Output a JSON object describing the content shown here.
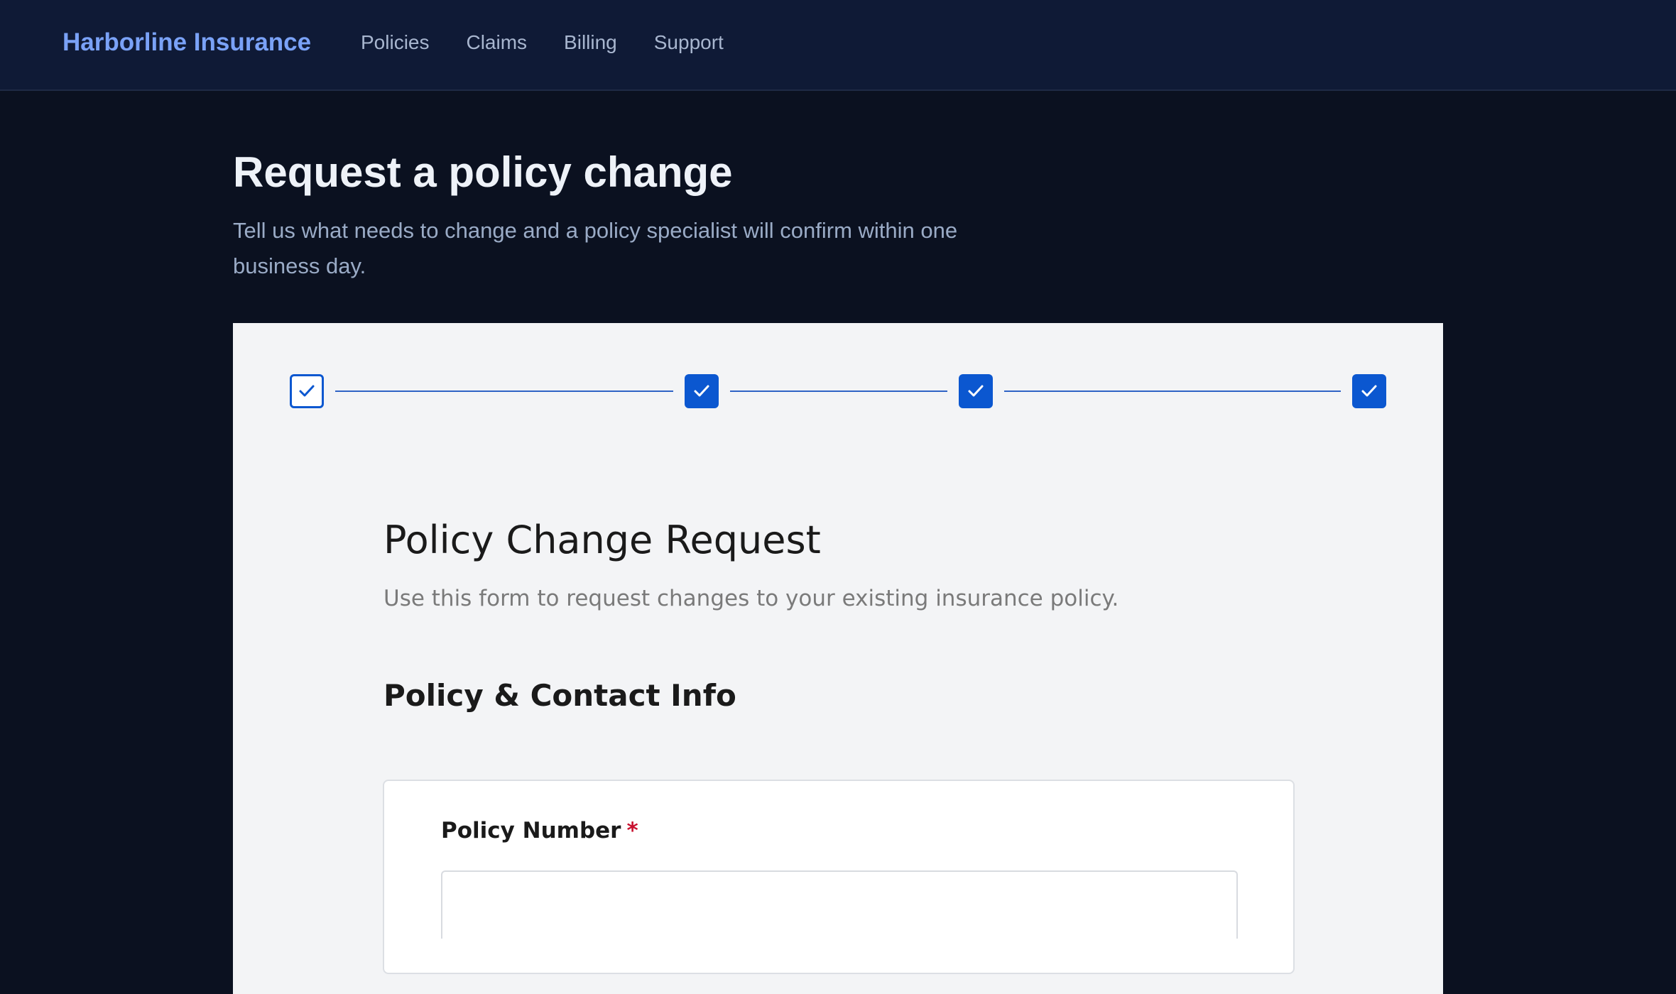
{
  "nav": {
    "brand": "Harborline Insurance",
    "links": [
      "Policies",
      "Claims",
      "Billing",
      "Support"
    ]
  },
  "hero": {
    "title": "Request a policy change",
    "subtitle": "Tell us what needs to change and a policy specialist will confirm within one business day."
  },
  "stepper": {
    "total_steps": 4,
    "completed_steps": 4,
    "current_step": 1
  },
  "form": {
    "title": "Policy Change Request",
    "description": "Use this form to request changes to your existing insurance policy.",
    "section_title": "Policy & Contact Info",
    "fields": {
      "policy_number": {
        "label": "Policy Number",
        "required_mark": "*",
        "value": "",
        "placeholder": ""
      }
    }
  },
  "colors": {
    "nav_bg": "#0f1a36",
    "page_bg": "#0b1120",
    "brand": "#7aa2f7",
    "accent": "#0b57d0",
    "required": "#c8102e",
    "card_bg": "#f3f4f6"
  },
  "icons": {
    "step": "check-icon"
  }
}
